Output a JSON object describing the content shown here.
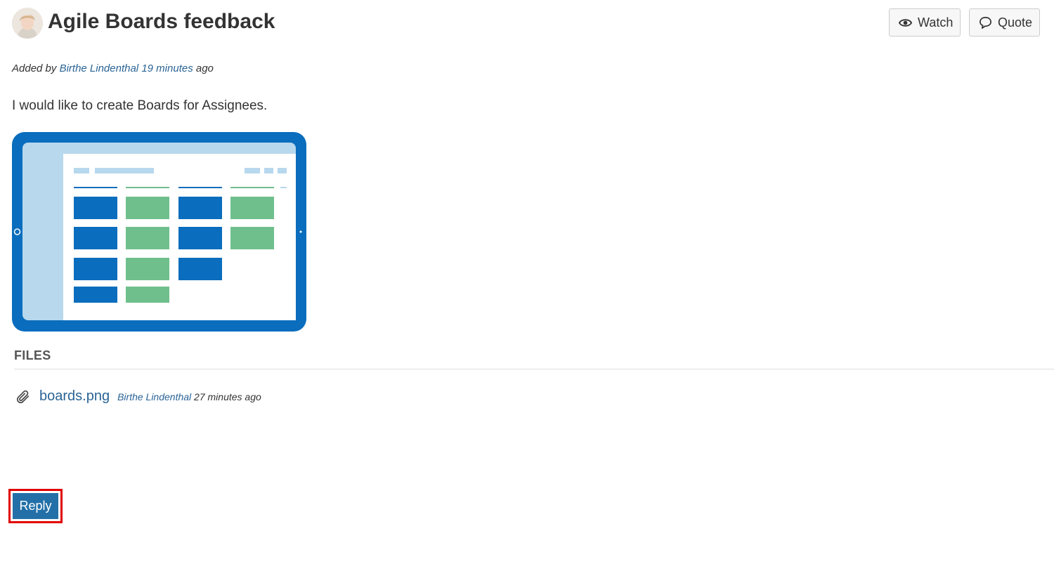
{
  "post": {
    "title": "Agile Boards feedback",
    "added_by_prefix": "Added by",
    "author": "Birthe Lindenthal",
    "time": "19 minutes",
    "time_suffix": "ago",
    "body": "I would like to create Boards for Assignees."
  },
  "actions": {
    "watch_label": "Watch",
    "quote_label": "Quote",
    "watch_icon": "eye-icon",
    "quote_icon": "speech-bubble-icon"
  },
  "files": {
    "heading": "FILES",
    "items": [
      {
        "name": "boards.png",
        "author": "Birthe Lindenthal",
        "time": "27 minutes ago",
        "icon": "paperclip-icon"
      }
    ]
  },
  "reply": {
    "label": "Reply"
  },
  "colors": {
    "link": "#2a6496",
    "primary_button": "#2370a8",
    "highlight_border": "#e00000",
    "board_blue": "#0a6dbd",
    "board_green": "#6fbf8d",
    "board_light": "#b8d8ee"
  }
}
